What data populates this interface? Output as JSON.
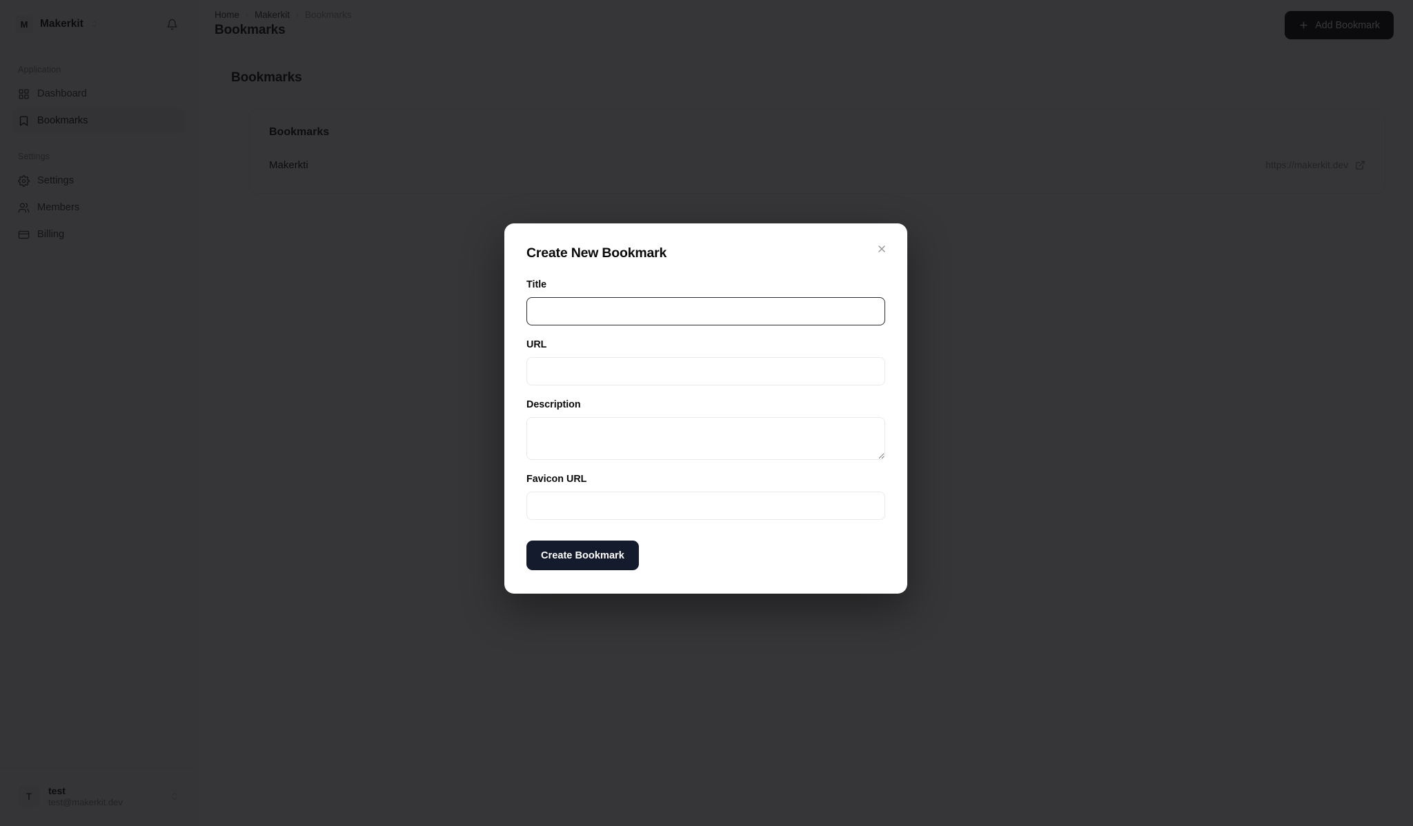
{
  "sidebar": {
    "workspace": {
      "avatar_initial": "M",
      "name": "Makerkit",
      "chevron_icon": "chevron-up-down-icon"
    },
    "notifications_icon": "bell-icon",
    "groups": [
      {
        "label": "Application",
        "items": [
          {
            "label": "Dashboard",
            "icon": "layout-grid-icon",
            "active": false
          },
          {
            "label": "Bookmarks",
            "icon": "bookmark-icon",
            "active": true
          }
        ]
      },
      {
        "label": "Settings",
        "items": [
          {
            "label": "Settings",
            "icon": "gear-icon",
            "active": false
          },
          {
            "label": "Members",
            "icon": "users-icon",
            "active": false
          },
          {
            "label": "Billing",
            "icon": "credit-card-icon",
            "active": false
          }
        ]
      }
    ],
    "user": {
      "avatar_initial": "T",
      "name": "test",
      "email": "test@makerkit.dev",
      "chevron_icon": "chevron-up-down-icon"
    }
  },
  "topbar": {
    "breadcrumb": [
      {
        "label": "Home",
        "current": false
      },
      {
        "label": "Makerkit",
        "current": false
      },
      {
        "label": "Bookmarks",
        "current": true
      }
    ],
    "separator": "›",
    "page_title": "Bookmarks",
    "add_button": {
      "label": "Add Bookmark",
      "icon": "plus-icon"
    }
  },
  "content": {
    "section_heading": "Bookmarks",
    "card": {
      "title": "Bookmarks",
      "rows": [
        {
          "name": "Makerkti",
          "url": "https://makerkit.dev",
          "external_icon": "external-link-icon"
        }
      ]
    }
  },
  "modal": {
    "title": "Create New Bookmark",
    "close_icon": "close-icon",
    "fields": [
      {
        "label": "Title",
        "type": "input",
        "value": "",
        "placeholder": "",
        "focused": true
      },
      {
        "label": "URL",
        "type": "input",
        "value": "",
        "placeholder": "",
        "focused": false
      },
      {
        "label": "Description",
        "type": "textarea",
        "value": "",
        "placeholder": "",
        "focused": false
      },
      {
        "label": "Favicon URL",
        "type": "input",
        "value": "",
        "placeholder": "",
        "focused": false
      }
    ],
    "submit_label": "Create Bookmark"
  },
  "colors": {
    "accent_dark": "#131b2c",
    "button_dark": "#111116",
    "overlay": "#0a0a0c",
    "muted_text": "#8b8b8f"
  }
}
